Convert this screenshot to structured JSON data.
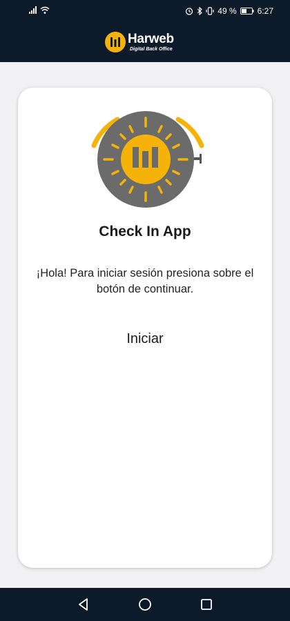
{
  "status_bar": {
    "battery_text": "49 %",
    "time": "6:27"
  },
  "header": {
    "logo_text": "Harweb",
    "logo_subtitle": "Digital Back Office"
  },
  "card": {
    "title": "Check In App",
    "message": "¡Hola! Para iniciar sesión presiona sobre el botón de continuar.",
    "start_label": "Iniciar"
  },
  "colors": {
    "brand_dark": "#0c1a2a",
    "accent_yellow": "#f5b30a",
    "stopwatch_gray": "#6b6b6b"
  },
  "icons": {
    "back": "back-triangle-icon",
    "home": "home-circle-icon",
    "recents": "recents-square-icon"
  }
}
